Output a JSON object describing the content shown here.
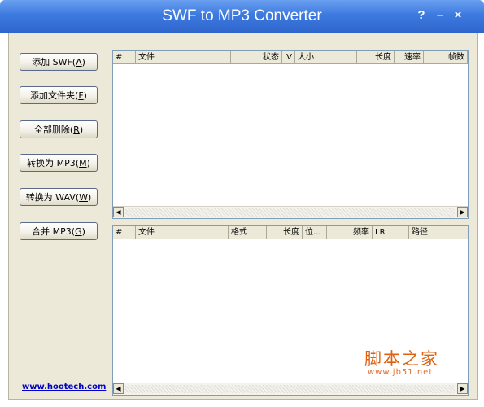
{
  "window": {
    "title": "SWF to MP3 Converter",
    "help": "?",
    "minimize": "–",
    "close": "×"
  },
  "sidebar": {
    "add_swf": {
      "text": "添加 SWF(",
      "key": "A",
      "end": ")"
    },
    "add_folder": {
      "text": "添加文件夹(",
      "key": "F",
      "end": ")"
    },
    "remove_all": {
      "text": "全部删除(",
      "key": "R",
      "end": ")"
    },
    "to_mp3": {
      "text": "转换为 MP3(",
      "key": "M",
      "end": ")"
    },
    "to_wav": {
      "text": "转换为 WAV(",
      "key": "W",
      "end": ")"
    },
    "merge": {
      "text": "合并 MP3(",
      "key": "G",
      "end": ")"
    },
    "link": "www.hootech.com"
  },
  "top_list": {
    "columns": [
      "#",
      "文件",
      "状态",
      "V",
      "大小",
      "长度",
      "速率",
      "帧数"
    ]
  },
  "bottom_list": {
    "columns": [
      "#",
      "文件",
      "格式",
      "长度",
      "位...",
      "频率",
      "LR",
      "路径"
    ]
  },
  "scroll": {
    "left": "◀",
    "right": "▶"
  },
  "watermark": {
    "main": "脚本之家",
    "sub": "www.jb51.net"
  }
}
